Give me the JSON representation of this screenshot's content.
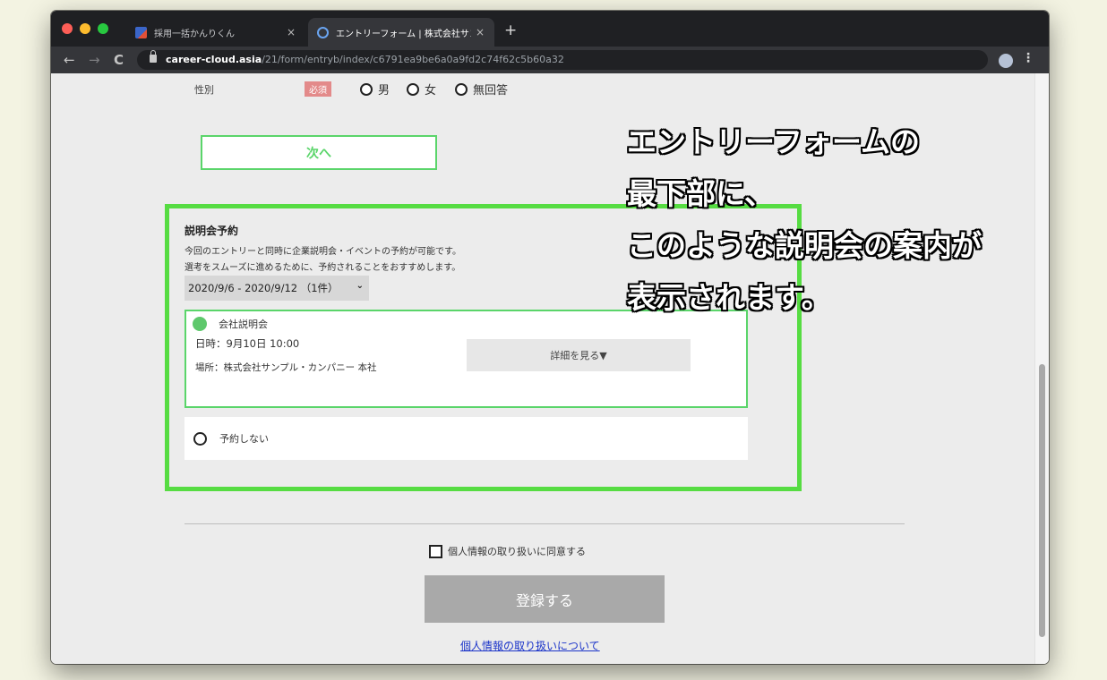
{
  "browser": {
    "tabs": [
      {
        "title": "採用一括かんりくん",
        "close": "×"
      },
      {
        "title": "エントリーフォーム | 株式会社サン",
        "close": "×"
      }
    ],
    "new_tab": "+",
    "nav": {
      "back": "←",
      "forward": "→",
      "reload": "C"
    },
    "url_host": "career-cloud.asia",
    "url_path": "/21/form/entryb/index/c6791ea9be6a0a9fd2c74f62c5b60a32",
    "star": "☆",
    "menu": "⋮"
  },
  "form": {
    "gender": {
      "label": "性別",
      "required": "必須",
      "options": [
        "男",
        "女",
        "無回答"
      ]
    },
    "next_button": "次へ",
    "seminar": {
      "title": "説明会予約",
      "desc1": "今回のエントリーと同時に企業説明会・イベントの予約が可能です。",
      "desc2": "選考をスムーズに進めるために、予約されることをおすすめします。",
      "week_select": "2020/9/6 - 2020/9/12 （1件）",
      "chevron": "⌄",
      "event": {
        "name": "会社説明会",
        "time": "日時：9月10日 10:00",
        "place": "場所：株式会社サンプル・カンパニー 本社",
        "details_button": "詳細を見る▼"
      },
      "no_reserve": "予約しない"
    },
    "consent": "個人情報の取り扱いに同意する",
    "register_button": "登録する",
    "privacy_link": "個人情報の取り扱いについて"
  },
  "annotation": {
    "line1": "エントリーフォームの",
    "line2": "最下部に、",
    "line3": "このような説明会の案内が",
    "line4": "表示されます。"
  },
  "colors": {
    "accent_green": "#5ad56a",
    "highlight_green": "#56dc42",
    "required_red": "#e38a8a",
    "link_blue": "#1a33c9"
  }
}
